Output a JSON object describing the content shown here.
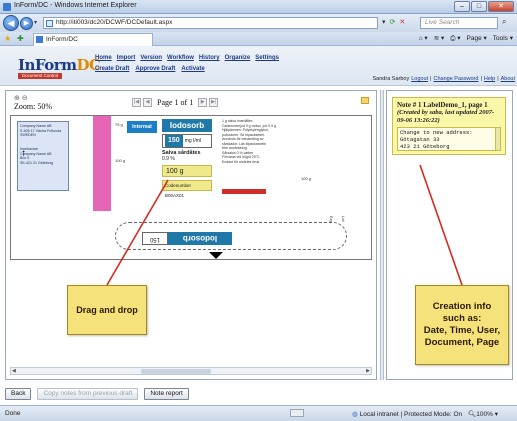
{
  "window": {
    "title": "InForm/DC - Windows Internet Explorer",
    "min": "–",
    "max": "□",
    "close": "✕"
  },
  "browser": {
    "url": "http://iti003/dc20/DCWF/DCDefault.aspx",
    "search_placeholder": "Live Search",
    "tab_title": "InForm/DC",
    "commands": [
      "Page ▾",
      "Tools ▾"
    ],
    "back_glyph": "◀",
    "forward_glyph": "▶"
  },
  "app": {
    "logo_main": "InForm",
    "logo_accent": "DC",
    "logo_sub": "Document Control",
    "menu": [
      "Home",
      "Import",
      "Version",
      "Workflow",
      "History",
      "Organize",
      "Settings"
    ],
    "actions": [
      "Create Draft",
      "Approve Draft",
      "Activate"
    ],
    "user": "Sandra Sarboy",
    "user_links": [
      "Logout",
      "Change Password",
      "Help",
      "About"
    ]
  },
  "viewer": {
    "zoom": "Zoom: 50%",
    "page_label": "Page 1 of 1",
    "pager_buttons": [
      "|◀",
      "◀",
      "▶",
      "▶|"
    ],
    "artwork": {
      "address_lines": [
        "Company Name AB",
        "S-405 17 Västra Frölunda",
        "SWEDEN",
        "",
        "",
        "Innehavare",
        "Company Name AB",
        "Box 0",
        "SE-421 21 Göteborg"
      ],
      "brand": "Intermat",
      "product": "Iodosorb",
      "dose_num": "150",
      "dose_unit": "mg I/ml",
      "salva_title": "Salva sårdåtes",
      "salva_sub": "0.9 %",
      "weight": "100 g",
      "code": "Codenumber B00AX01",
      "text_lines": [
        "1 g salva innehåller:",
        "Cadexomerjod 9 g motsv. jod 0,9 g",
        "Hjälpämnen: Polyetylenglykol,",
        "poloxamer. Se bipacksedel.",
        "Används för behandling av",
        "sårskador. Läs bipacksedeln",
        "före användning.",
        "Sårsalva 0 % vatten",
        "Förvaras vid högst 25°C.",
        "Endast för utvärtes bruk."
      ],
      "small_texts": [
        "75 g",
        "100 g",
        "Exp.",
        "Lot"
      ]
    }
  },
  "note": {
    "title": "Note # 1 LabelDemo_1, page 1",
    "meta": "(Created by saba, last updated 2007-09-06 13:26:22)",
    "body_lines": [
      "Change to new address:",
      "Götagatan 33",
      "423 21 Göteborg"
    ]
  },
  "callouts": {
    "drag": "Drag and drop",
    "info_lines": [
      "Creation info",
      "such as:",
      "Date, Time, User,",
      "Document, Page"
    ]
  },
  "buttons": {
    "back": "Back",
    "copy_notes": "Copy notes from previous draft",
    "note_report": "Note report"
  },
  "status": {
    "left": "Done",
    "zone": "Local intranet | Protected Mode: On",
    "zoom": "100%"
  }
}
